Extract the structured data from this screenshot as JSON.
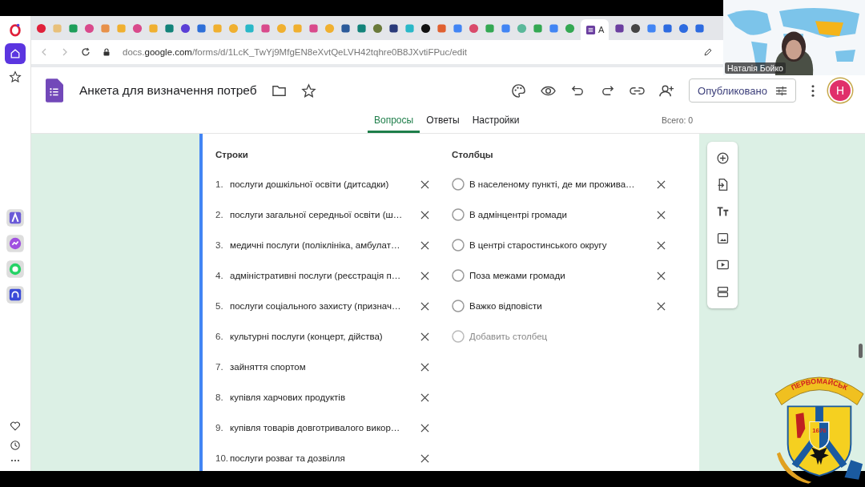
{
  "browser": {
    "active_tab_title": "A",
    "url": "docs.**google.com**/forms/d/1LcK_TwYj9MfgEN8eXvtQeLVH42tqhre0B8JXvtiFPuc/edit"
  },
  "form": {
    "title": "Анкета для визначення потреб",
    "publish_button": "Опубликовано",
    "avatar": "H",
    "tabs": [
      {
        "label": "Вопросы",
        "selected": true
      },
      {
        "label": "Ответы",
        "selected": false
      },
      {
        "label": "Настройки",
        "selected": false
      }
    ],
    "total": "Всего: 0"
  },
  "grid": {
    "rows_label": "Строки",
    "rows": [
      {
        "number": "1.",
        "text": "послуги дошкільної освіти (дитсадки)"
      },
      {
        "number": "2.",
        "text": "послуги загальної середньої освіти (ш…"
      },
      {
        "number": "3.",
        "text": "медичні послуги (поліклініка, амбулат…"
      },
      {
        "number": "4.",
        "text": "адміністративні послуги (реєстрація п…"
      },
      {
        "number": "5.",
        "text": "послуги соціального захисту (признач…"
      },
      {
        "number": "6.",
        "text": "культурні послуги (концерт, дійства)"
      },
      {
        "number": "7.",
        "text": "зайняття спортом"
      },
      {
        "number": "8.",
        "text": "купівля харчових продуктів"
      },
      {
        "number": "9.",
        "text": "купівля товарів довготривалого викор…"
      },
      {
        "number": "10.",
        "text": "послуги розваг та дозвілля"
      }
    ],
    "columns_label": "Столбцы",
    "columns": [
      {
        "text": "В населеному пункті, де ми прожива…"
      },
      {
        "text": "В адмінцентрі громади"
      },
      {
        "text": "В центрі старостинського округу"
      },
      {
        "text": "Поза межами громади"
      },
      {
        "text": "Важко відповісти"
      }
    ],
    "add_column_placeholder": "Добавить столбец"
  },
  "video": {
    "name": "Наталія Бойко"
  },
  "crest": {
    "banner": "ПЕРВОМАЙСЬК",
    "year": "1676"
  }
}
